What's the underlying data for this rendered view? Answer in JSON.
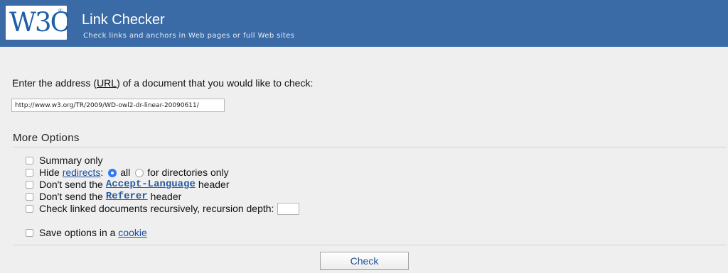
{
  "header": {
    "logo_text": "W3C",
    "logo_reg": "®",
    "title": "Link Checker",
    "subtitle": "Check links and anchors in Web pages or full Web sites"
  },
  "form": {
    "prompt_before": "Enter the address (",
    "prompt_abbr": "URL",
    "prompt_after": ") of a document that you would like to check:",
    "uri_value": "http://www.w3.org/TR/2009/WD-owl2-dr-linear-20090611/"
  },
  "options": {
    "heading": "More Options",
    "summary_only": "Summary only",
    "hide_label": "Hide",
    "redirects_link": "redirects",
    "hide_colon": ":",
    "radio_all": "all",
    "radio_dirs": "for directories only",
    "no_accept_before": "Don't send the",
    "accept_language": "Accept-Language",
    "no_accept_after": "header",
    "no_referer_before": "Don't send the",
    "referer": "Referer",
    "no_referer_after": "header",
    "recursive": "Check linked documents recursively, recursion depth:",
    "depth_value": "",
    "save_before": "Save options in a",
    "cookie_link": "cookie"
  },
  "submit": {
    "label": "Check"
  },
  "colors": {
    "header_bg": "#3b6ba7",
    "content_bg": "#efefef",
    "link": "#1a4fa3",
    "radio_checked": "#2e7bf6"
  }
}
